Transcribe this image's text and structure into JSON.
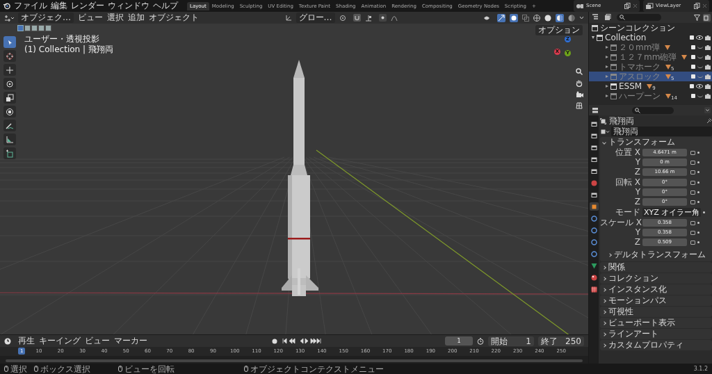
{
  "top_bar": {
    "menus": [
      "ファイル",
      "編集",
      "レンダー",
      "ウィンドウ",
      "ヘルプ"
    ],
    "workspaces": [
      {
        "label": "Layout",
        "selected": true
      },
      {
        "label": "Modeling",
        "selected": false
      },
      {
        "label": "Sculpting",
        "selected": false
      },
      {
        "label": "UV Editing",
        "selected": false
      },
      {
        "label": "Texture Paint",
        "selected": false
      },
      {
        "label": "Shading",
        "selected": false
      },
      {
        "label": "Animation",
        "selected": false
      },
      {
        "label": "Rendering",
        "selected": false
      },
      {
        "label": "Compositing",
        "selected": false
      },
      {
        "label": "Geometry Nodes",
        "selected": false
      },
      {
        "label": "Scripting",
        "selected": false
      }
    ],
    "add_tab": "+",
    "scene": "Scene",
    "view_layer": "ViewLayer"
  },
  "viewport": {
    "mode": "オブジェク…",
    "menus": [
      "ビュー",
      "選択",
      "追加",
      "オブジェクト"
    ],
    "orientation": "グロー…",
    "options": "オプション",
    "view_name": "ユーザー・透視投影",
    "context": "(1) Collection | 飛翔両",
    "select_modes": [
      {
        "selected": true
      },
      {
        "selected": false
      },
      {
        "selected": false
      },
      {
        "selected": false
      },
      {
        "selected": false
      }
    ],
    "tools": [
      {
        "selected": true
      },
      {
        "selected": false
      },
      {
        "selected": false
      },
      {
        "selected": false
      },
      {
        "selected": false
      },
      {
        "selected": false
      },
      {
        "selected": false
      },
      {
        "selected": false
      },
      {
        "selected": false
      }
    ],
    "axes": [
      {
        "label": "Z",
        "color": "#2f6fd6"
      },
      {
        "label": "Y",
        "color": "#6ea31a"
      },
      {
        "label": "X",
        "color": "#d83a4c"
      }
    ]
  },
  "outliner": {
    "root": "シーンコレクション",
    "collection": {
      "name": "Collection",
      "expanded": true,
      "checked": true,
      "visible": true,
      "children": [
        {
          "name": "２０mm弾",
          "checked": true,
          "visible": false,
          "selected": false
        },
        {
          "name": "１２７mm砲弾",
          "checked": true,
          "visible": false,
          "selected": false
        },
        {
          "name": "トマホーク",
          "checked": true,
          "visible": false,
          "selected": false,
          "count": "5"
        },
        {
          "name": "アスロック",
          "checked": true,
          "visible": false,
          "selected": true,
          "count": "5"
        },
        {
          "name": "ESSM",
          "checked": true,
          "visible": true,
          "selected": false,
          "count": "9"
        },
        {
          "name": "ハープーン",
          "checked": true,
          "visible": false,
          "selected": false,
          "count": "14"
        }
      ]
    }
  },
  "properties": {
    "tabs": [
      {
        "selected": false
      },
      {
        "selected": false
      },
      {
        "selected": false
      },
      {
        "selected": false
      },
      {
        "selected": false
      },
      {
        "selected": false
      },
      {
        "selected": false
      },
      {
        "selected": true
      },
      {
        "selected": false
      },
      {
        "selected": false
      },
      {
        "selected": false
      },
      {
        "selected": false
      },
      {
        "selected": false
      },
      {
        "selected": false
      },
      {
        "selected": false
      }
    ],
    "object_name": "飛翔両",
    "name_field": "飛翔両",
    "transform": {
      "title": "トランスフォーム",
      "expanded": true,
      "rows": [
        {
          "kind": "vector",
          "label": "位置",
          "fields": [
            {
              "axis": "X",
              "value": "4.6471 m"
            },
            {
              "axis": "Y",
              "value": "0 m"
            },
            {
              "axis": "Z",
              "value": "10.66 m"
            }
          ]
        },
        {
          "kind": "vector",
          "label": "回転",
          "fields": [
            {
              "axis": "X",
              "value": "0°"
            },
            {
              "axis": "Y",
              "value": "0°"
            },
            {
              "axis": "Z",
              "value": "0°"
            }
          ]
        },
        {
          "kind": "enum",
          "label": "モード",
          "value": "XYZ オイラー角"
        },
        {
          "kind": "vector",
          "label": "スケール",
          "fields": [
            {
              "axis": "X",
              "value": "0.358"
            },
            {
              "axis": "Y",
              "value": "0.358"
            },
            {
              "axis": "Z",
              "value": "0.509"
            }
          ]
        }
      ],
      "subpanel": "デルタトランスフォーム"
    },
    "panels": [
      "関係",
      "コレクション",
      "インスタンス化",
      "モーションパス",
      "可視性",
      "ビューポート表示",
      "ラインアート",
      "カスタムプロパティ"
    ]
  },
  "timeline": {
    "menus": [
      "再生",
      "キーイング",
      "ビュー",
      "マーカー"
    ],
    "current_frame": "1",
    "start_label": "開始",
    "start": "1",
    "end_label": "終了",
    "end": "250",
    "playhead": "1",
    "ticks": [
      "10",
      "20",
      "30",
      "40",
      "50",
      "60",
      "70",
      "80",
      "90",
      "100",
      "110",
      "120",
      "130",
      "140",
      "150",
      "160",
      "170",
      "180",
      "190",
      "200",
      "210",
      "220",
      "230",
      "240",
      "250"
    ]
  },
  "status_bar": {
    "items": [
      "選択",
      "ボックス選択",
      "ビューを回転",
      "オブジェクトコンテクストメニュー"
    ],
    "version": "3.1.2"
  }
}
